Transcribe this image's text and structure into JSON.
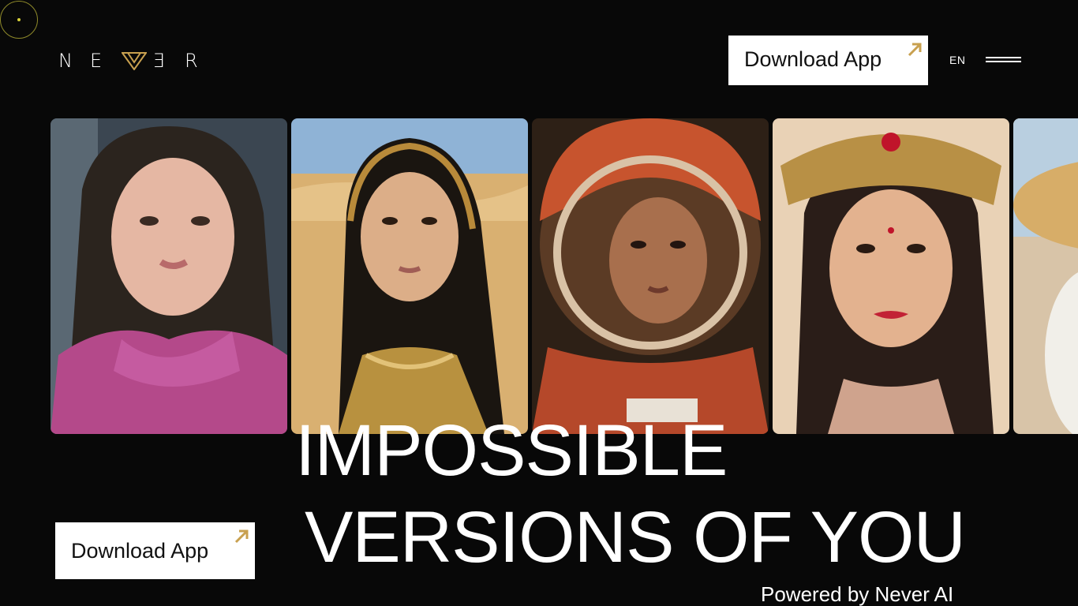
{
  "brand": {
    "logo_letters": [
      "N",
      "E",
      "V",
      "E",
      "R"
    ],
    "accent_color": "#c8a04f"
  },
  "header": {
    "download_label": "Download App",
    "language": "EN"
  },
  "hero": {
    "headline_line1": "IMPOSSIBLE",
    "headline_line2": "VERSIONS OF YOU",
    "subline": "Powered by Never AI",
    "download_label": "Download App"
  },
  "gallery": [
    {
      "name": "original-selfie"
    },
    {
      "name": "desert-portrait"
    },
    {
      "name": "astronaut-portrait"
    },
    {
      "name": "queen-portrait"
    },
    {
      "name": "sunhat-portrait"
    }
  ],
  "icons": {
    "download_arrow": "arrow-up-right-icon",
    "menu": "hamburger-icon"
  }
}
